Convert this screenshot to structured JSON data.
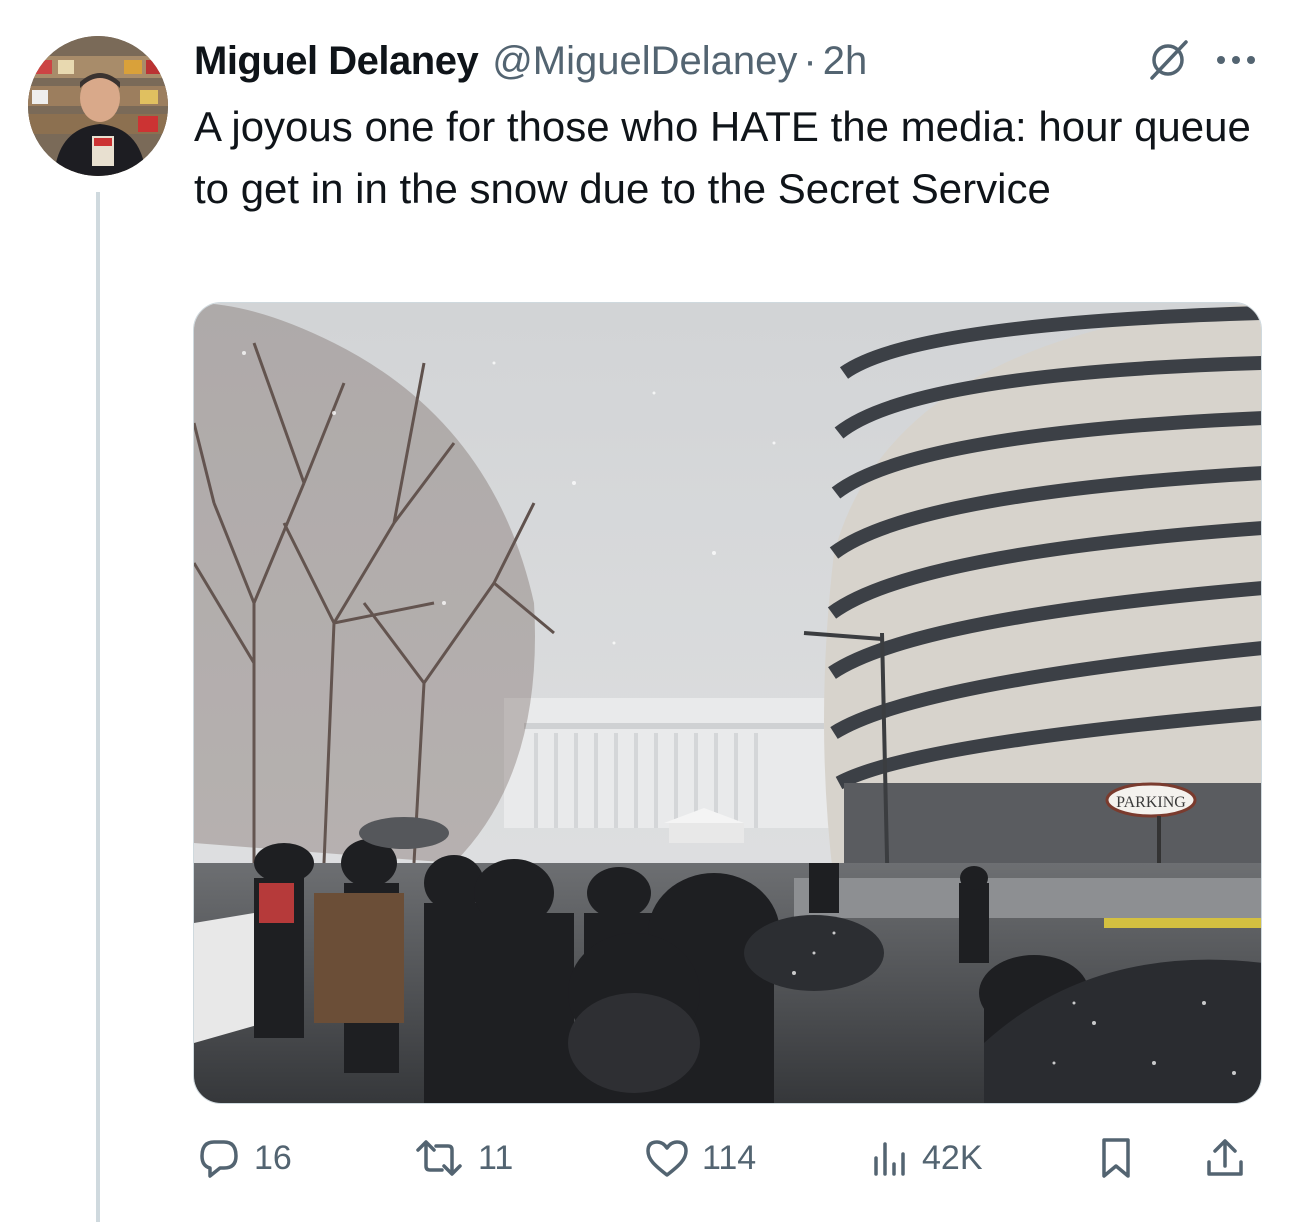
{
  "author": {
    "name": "Miguel Delaney",
    "handle": "@MiguelDelaney",
    "separator": "·",
    "time": "2h"
  },
  "tweet": {
    "text": "A joyous one for those who HATE the media: hour queue to get in in the snow due to the Secret Service"
  },
  "media": {
    "signs": {
      "parking": "PARKING"
    }
  },
  "actions": {
    "replies": "16",
    "reposts": "11",
    "likes": "114",
    "views": "42K"
  },
  "icons": {
    "grok": "grok-icon",
    "more": "more-icon",
    "reply": "reply-icon",
    "repost": "repost-icon",
    "like": "like-icon",
    "views": "views-icon",
    "bookmark": "bookmark-icon",
    "share": "share-icon"
  },
  "colors": {
    "text": "#0f1419",
    "secondary": "#536471",
    "thread_line": "#cfd9de"
  }
}
